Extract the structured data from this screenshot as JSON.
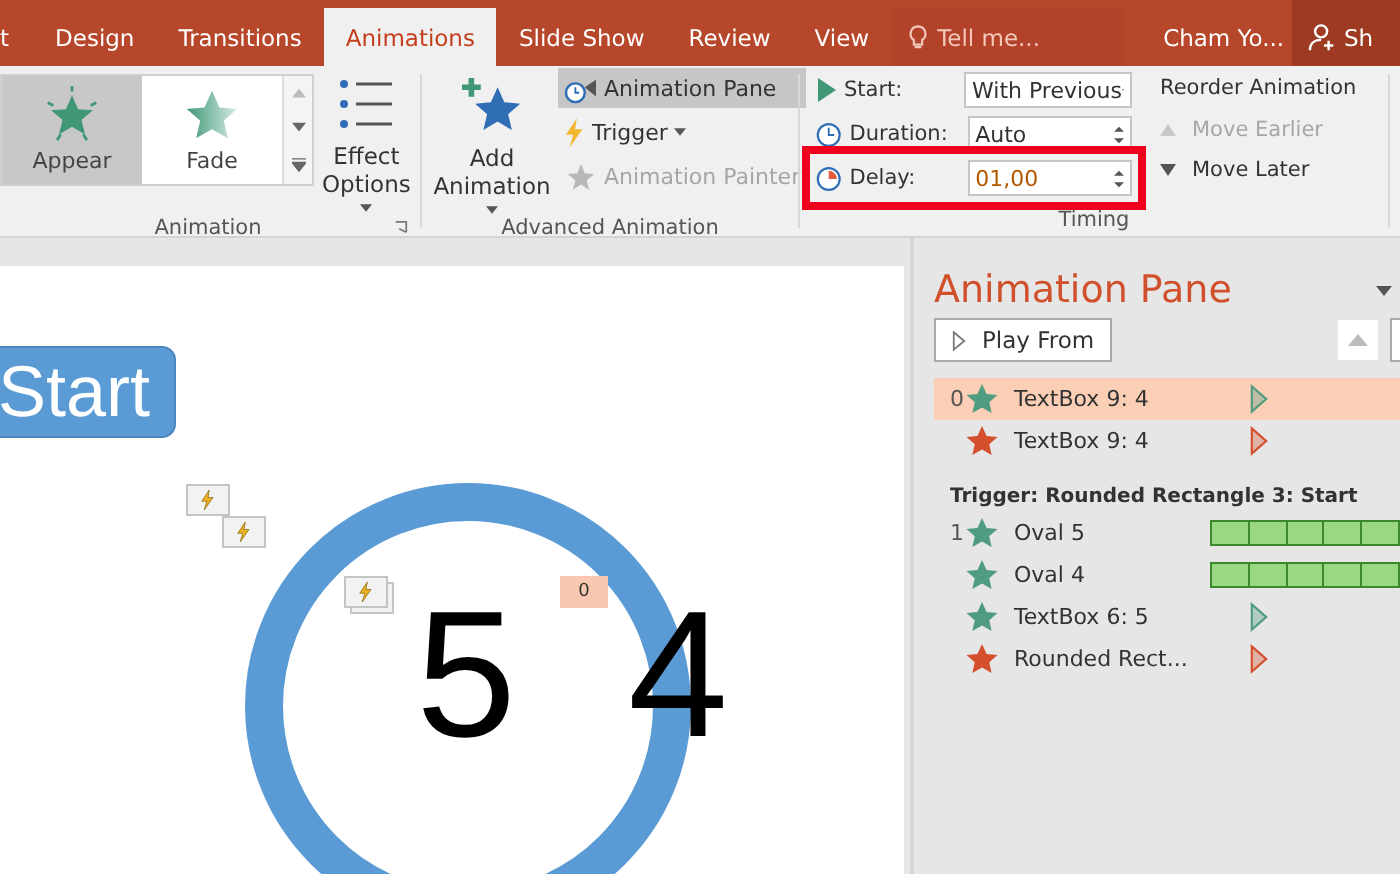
{
  "tabs": [
    {
      "label": "t",
      "selected": false
    },
    {
      "label": "Design",
      "selected": false
    },
    {
      "label": "Transitions",
      "selected": false
    },
    {
      "label": "Animations",
      "selected": true
    },
    {
      "label": "Slide Show",
      "selected": false
    },
    {
      "label": "Review",
      "selected": false
    },
    {
      "label": "View",
      "selected": false
    }
  ],
  "tell_me": {
    "placeholder": "Tell me..."
  },
  "user": "Cham Yo...",
  "share": "Sh",
  "animation_group": {
    "label": "Animation",
    "gallery": [
      {
        "label": "Appear",
        "selected": true
      },
      {
        "label": "Fade",
        "selected": false
      }
    ],
    "effect_options": "Effect Options"
  },
  "advanced_group": {
    "label": "Advanced Animation",
    "add_animation": "Add Animation",
    "animation_pane": {
      "label": "Animation Pane",
      "on": true
    },
    "trigger": "Trigger",
    "animation_painter": {
      "label": "Animation Painter",
      "disabled": true
    }
  },
  "timing_group": {
    "label": "Timing",
    "start": {
      "label": "Start:",
      "value": "With Previous"
    },
    "duration": {
      "label": "Duration:",
      "value": "Auto"
    },
    "delay": {
      "label": "Delay:",
      "value": "01,00",
      "highlighted": true
    },
    "reorder_title": "Reorder Animation",
    "move_earlier": {
      "label": "Move Earlier",
      "disabled": true
    },
    "move_later": {
      "label": "Move Later",
      "disabled": false
    }
  },
  "slide": {
    "start_button": "Start",
    "tag": "0",
    "digits": [
      "5",
      "4"
    ]
  },
  "pane": {
    "title": "Animation Pane",
    "play_from": "Play From",
    "groups": [
      {
        "items": [
          {
            "number": "0",
            "name": "TextBox 9: 4",
            "color": "#4f9c80",
            "kind": "arrow",
            "selected": true
          },
          {
            "name": "TextBox 9: 4",
            "color": "#d4502c",
            "kind": "arrow",
            "selected": false
          }
        ]
      },
      {
        "header": "Trigger: Rounded Rectangle 3: Start",
        "items": [
          {
            "number": "1",
            "name": "Oval 5",
            "color": "#4f9c80",
            "kind": "bar",
            "selected": false
          },
          {
            "name": "Oval 4",
            "color": "#4f9c80",
            "kind": "bar",
            "selected": false
          },
          {
            "name": "TextBox 6: 5",
            "color": "#4f9c80",
            "kind": "arrow",
            "selected": false
          },
          {
            "name": "Rounded Rect...",
            "color": "#d4502c",
            "kind": "arrow",
            "selected": false
          }
        ]
      }
    ]
  }
}
